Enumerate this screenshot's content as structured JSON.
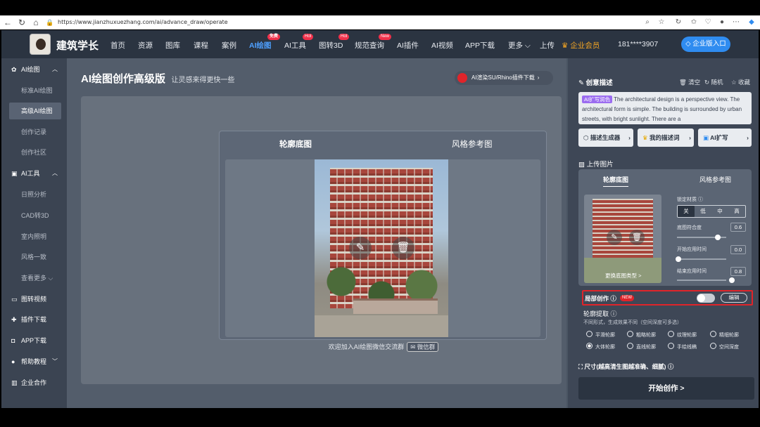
{
  "browser": {
    "url": "https://www.jianzhuxuezhang.com/ai/advance_draw/operate",
    "back": "←",
    "refresh": "↻",
    "home": "⌂"
  },
  "header": {
    "site_name": "建筑学长",
    "nav": [
      {
        "label": "首页"
      },
      {
        "label": "资源"
      },
      {
        "label": "图库"
      },
      {
        "label": "课程"
      },
      {
        "label": "案例"
      },
      {
        "label": "AI绘图",
        "badge": "免费"
      },
      {
        "label": "AI工具",
        "badge": "Hot"
      },
      {
        "label": "图转3D",
        "badge": "Hot"
      },
      {
        "label": "规范查询",
        "badge": "New"
      },
      {
        "label": "AI插件"
      },
      {
        "label": "AI视频"
      },
      {
        "label": "APP下载"
      },
      {
        "label": "更多 ⌵"
      },
      {
        "label": "上传"
      }
    ],
    "vip": "企业会员",
    "phone": "181****3907",
    "enterprise_btn": "企业版入口"
  },
  "sidebar": {
    "groups": [
      {
        "label": "AI绘图",
        "items": [
          "标准AI绘图",
          "高级AI绘图",
          "创作记录",
          "创作社区"
        ]
      },
      {
        "label": "AI工具",
        "items": [
          "日照分析",
          "CAD转3D",
          "室内照明",
          "风格一致",
          "查看更多 ⌵"
        ]
      }
    ],
    "singles": [
      "图转视频",
      "插件下载",
      "APP下载",
      "帮助教程",
      "企业合作"
    ]
  },
  "main": {
    "title": "AI绘图创作高级版",
    "subtitle": "让灵感来得更快一些",
    "plugin_btn": "AI渲染SU/Rhino插件下载",
    "tab_outline": "轮廓底图",
    "tab_style": "风格参考图",
    "wechat_text": "欢迎加入AI绘图微信交流群",
    "wechat_btn": "微信群"
  },
  "panel": {
    "desc_title": "创意描述",
    "clear": "清空",
    "random": "随机",
    "collect": "收藏",
    "desc_tag": "AI扩写润色",
    "desc_text": "The architectural design is a perspective view. The architectural form is simple. The building is surrounded by urban streets, with bright sunlight. There are a",
    "chip1": "描述生成器",
    "chip2": "我的描述词",
    "chip3": "AI扩写",
    "upload_title": "上传图片",
    "upload_tab1": "轮廓底图",
    "upload_tab2": "风格参考图",
    "lock_material": "锁定材质",
    "seg": [
      "关",
      "低",
      "中",
      "高"
    ],
    "outline_fit": "底图符合度",
    "outline_fit_val": "0.6",
    "start_time": "开始应用时间",
    "start_time_val": "0.0",
    "end_time": "结束应用时间",
    "end_time_val": "0.8",
    "replace_text": "更换底图类型 >",
    "local_create": "局部创作",
    "new_badge": "NEW",
    "edit": "编辑",
    "extract_title": "轮廓提取",
    "extract_note": "不同形式，生成效果不同（空间深度可多选）",
    "radios": [
      "平滑轮廓",
      "粗略轮廓",
      "纹理轮廓",
      "精细轮廓",
      "大体轮廓",
      "直线轮廓",
      "手绘线稿",
      "空间深度"
    ],
    "selected_radio": "大体轮廓",
    "size_title": "尺寸(越高清生图越准确、细腻)",
    "start_btn": "开始创作 >"
  }
}
